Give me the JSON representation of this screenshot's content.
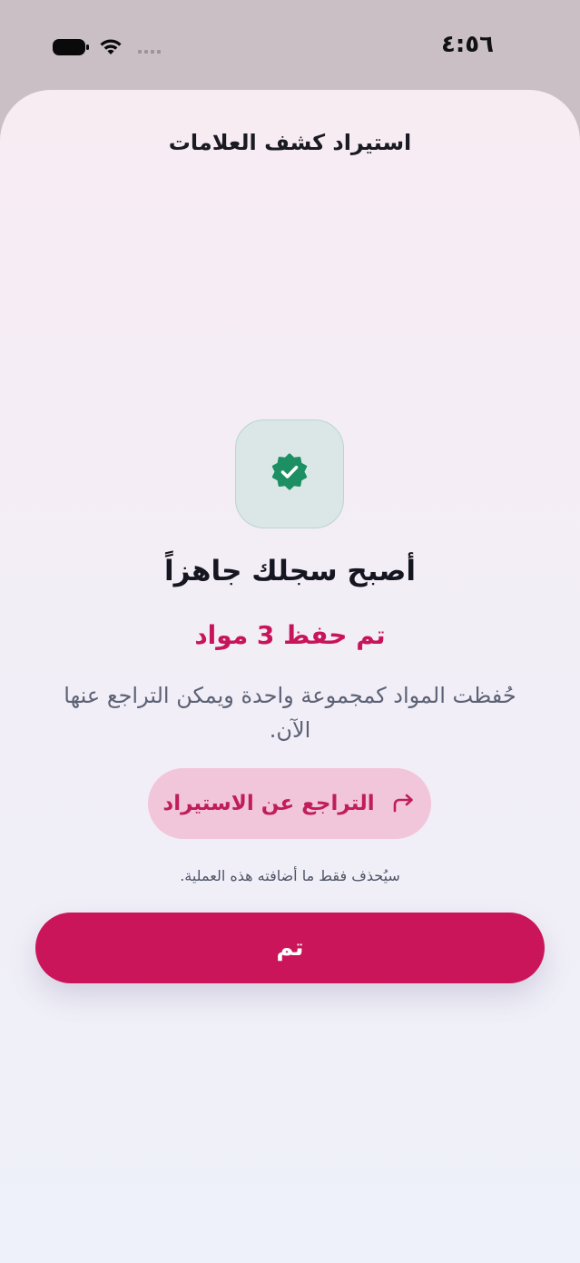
{
  "status_bar": {
    "time": "٤:٥٦",
    "icons": [
      "battery-icon",
      "wifi-icon",
      "signal-icon"
    ]
  },
  "sheet": {
    "title": "استيراد كشف العلامات"
  },
  "success": {
    "badge_icon": "verified-badge-icon",
    "headline": "أصبح سجلك جاهزاً",
    "saved_count": "تم حفظ 3 مواد",
    "description": "حُفظت المواد كمجموعة واحدة ويمكن التراجع عنها الآن."
  },
  "undo": {
    "label": "التراجع عن الاستيراد",
    "icon": "redo-arrow-icon",
    "note": "سيُحذف فقط ما أضافته هذه العملية."
  },
  "done": {
    "label": "تم"
  },
  "colors": {
    "accent": "#cb155b",
    "accent_text": "#c8145a",
    "undo_bg": "#f2c6da",
    "badge_green": "#1c8f63",
    "badge_tile": "#dbe6e6"
  }
}
